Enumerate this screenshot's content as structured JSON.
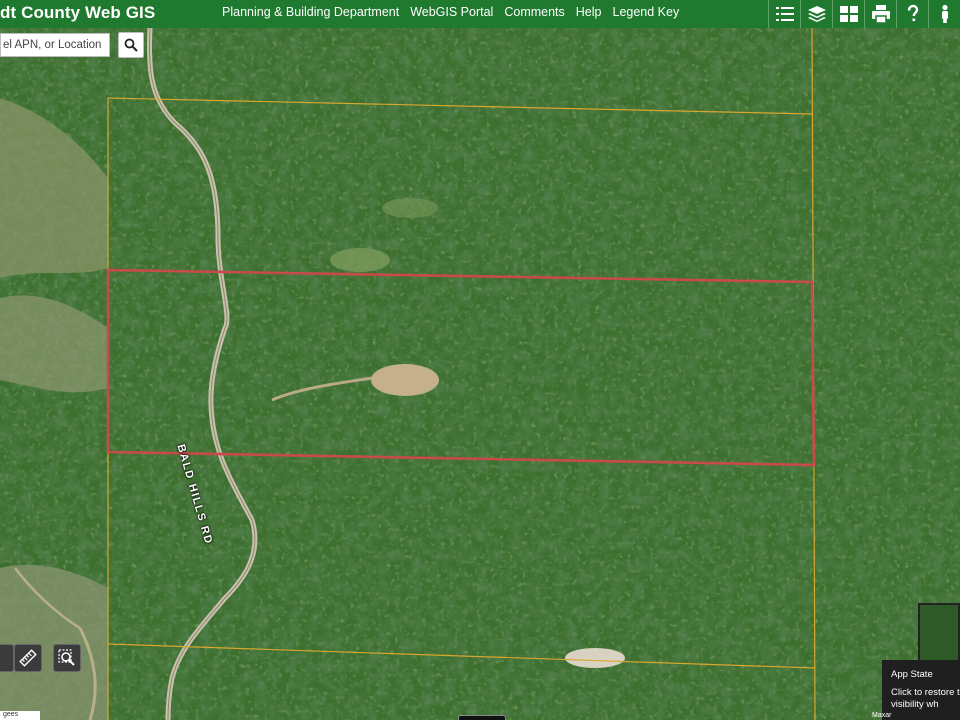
{
  "header": {
    "title": "dt County Web GIS",
    "nav": [
      "Planning & Building Department",
      "WebGIS Portal",
      "Comments",
      "Help",
      "Legend Key"
    ]
  },
  "toolbar": {
    "icons": [
      "list-icon",
      "layers-icon",
      "basemap-grid-icon",
      "print-icon",
      "help-question-icon",
      "street-view-person-icon"
    ]
  },
  "search": {
    "placeholder": "el APN, or Location",
    "value": ""
  },
  "map": {
    "road_label": "BALD HILLS RD",
    "parcel_outline_color": "#c94a4a",
    "parcel_line_color": "#d9a62e",
    "tools": [
      "measure-ruler-icon",
      "identify-zoom-icon"
    ]
  },
  "app_state": {
    "title": "App State",
    "message": "Click to restore the layers visibility wh"
  },
  "footer": {
    "scale": "gees",
    "attribution": "Maxar"
  }
}
